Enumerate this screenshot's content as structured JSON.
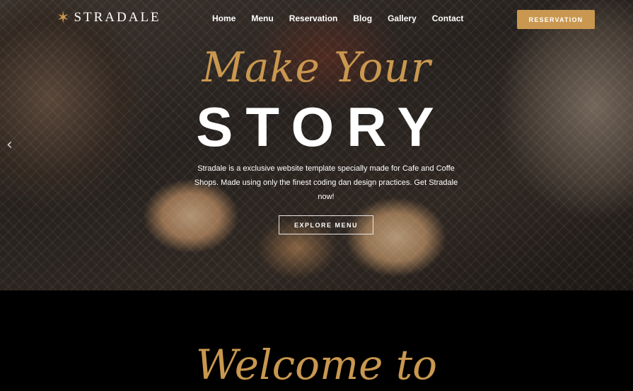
{
  "brand": {
    "name": "STRADALE",
    "logo_icon": "star-icon",
    "accent": "#c9974f"
  },
  "nav": {
    "links": [
      "Home",
      "Menu",
      "Reservation",
      "Blog",
      "Gallery",
      "Contact"
    ],
    "cta_label": "RESERVATION"
  },
  "hero": {
    "script_text": "Make Your",
    "title": "STORY",
    "description": "Stradale is a exclusive website template specially made for Cafe and Coffe Shops. Made using only the finest coding dan design practices. Get Stradale now!",
    "button_label": "EXPLORE MENU",
    "prev_icon": "chevron-left-icon"
  },
  "welcome": {
    "script_text": "Welcome to"
  }
}
